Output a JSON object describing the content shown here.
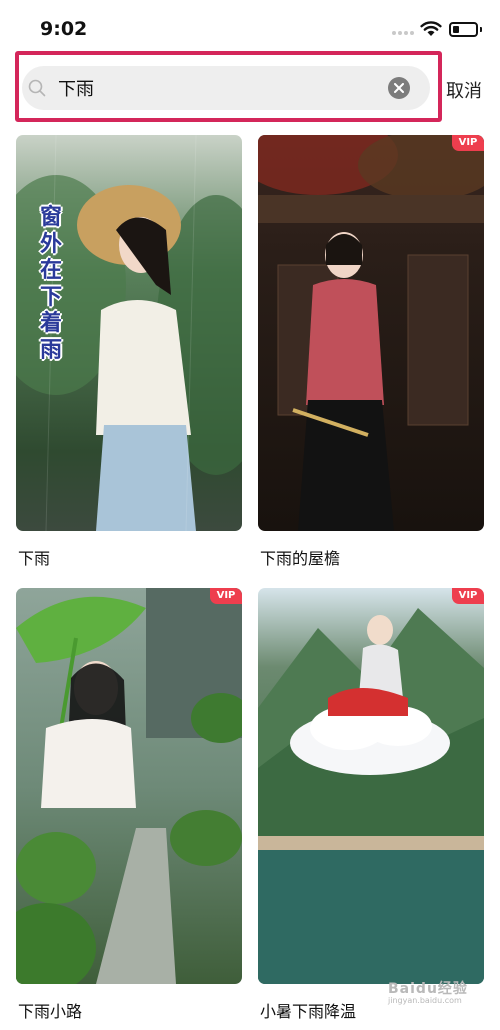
{
  "status_bar": {
    "time": "9:02"
  },
  "search": {
    "query": "下雨",
    "cancel_label": "取消"
  },
  "results": [
    {
      "title": "下雨",
      "vip": false,
      "overlay_text": "窗外在下着雨"
    },
    {
      "title": "下雨的屋檐",
      "vip": true
    },
    {
      "title": "下雨小路",
      "vip": true
    },
    {
      "title": "小暑下雨降温",
      "vip": true
    }
  ],
  "badge_label": "VIP",
  "watermark": {
    "text": "Baidu经验",
    "subtext": "jingyan.baidu.com"
  },
  "colors": {
    "highlight_border": "#d4265a",
    "vip_badge": "#ee3e4e",
    "search_bg": "#eeeeee",
    "overlay_text": "#2a3a9a"
  }
}
